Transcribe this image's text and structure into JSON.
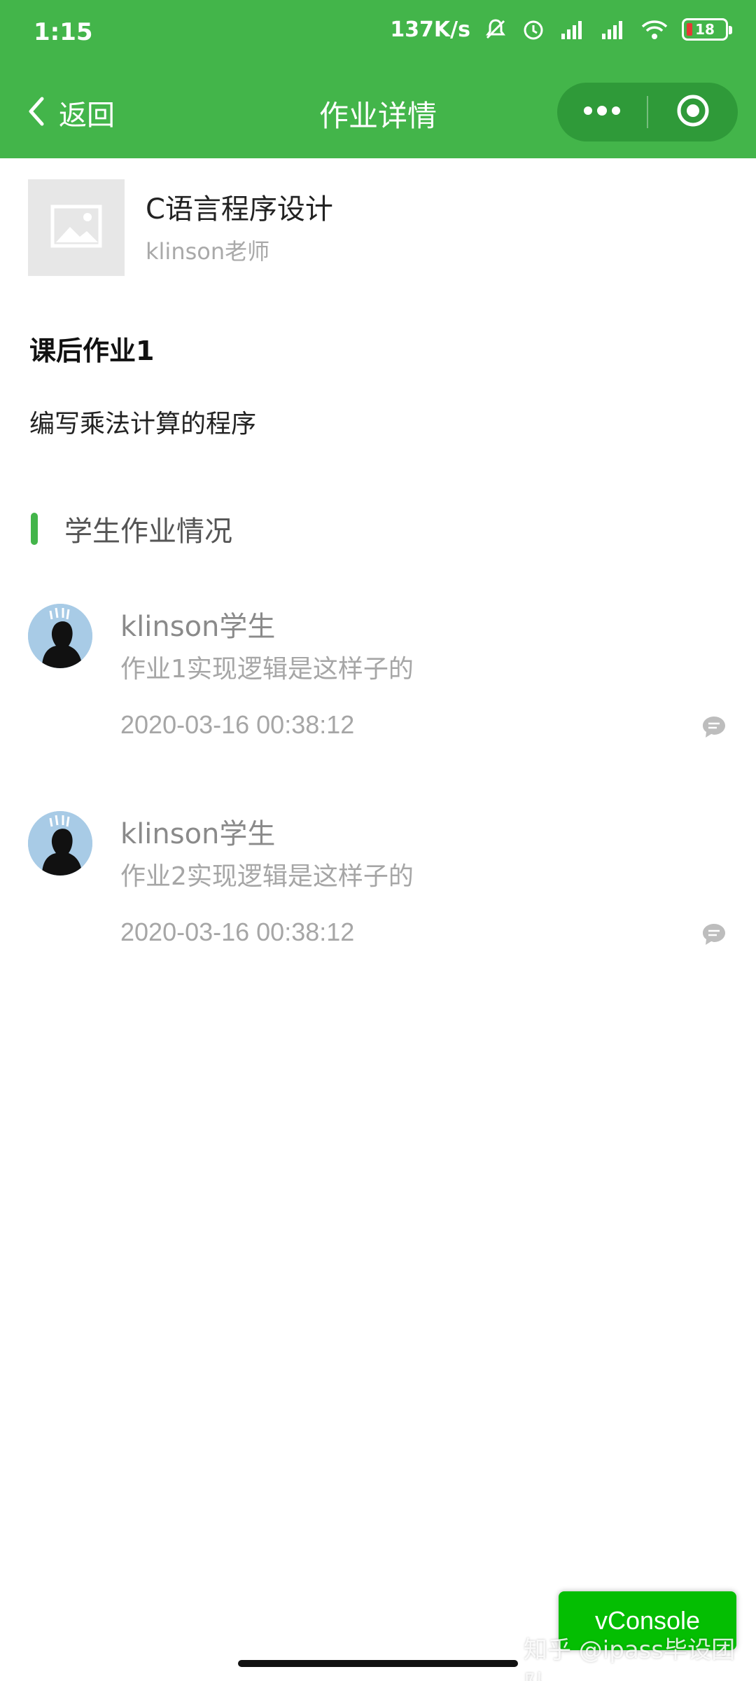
{
  "status_bar": {
    "time": "1:15",
    "speed": "137K/s",
    "battery": "18"
  },
  "nav": {
    "back_label": "返回",
    "title": "作业详情"
  },
  "course": {
    "title": "C语言程序设计",
    "teacher": "klinson老师"
  },
  "homework": {
    "title": "课后作业1",
    "description": "编写乘法计算的程序"
  },
  "section": {
    "label": "学生作业情况"
  },
  "submissions": [
    {
      "name": "klinson学生",
      "content": "作业1实现逻辑是这样子的",
      "time": "2020-03-16 00:38:12"
    },
    {
      "name": "klinson学生",
      "content": "作业2实现逻辑是这样子的",
      "time": "2020-03-16 00:38:12"
    }
  ],
  "vconsole": {
    "label": "vConsole"
  },
  "watermark": "知乎 @ipass毕设团队",
  "colors": {
    "brand_green": "#43b54a",
    "capsule_green": "#2f9a39",
    "vconsole_green": "#04be02"
  }
}
